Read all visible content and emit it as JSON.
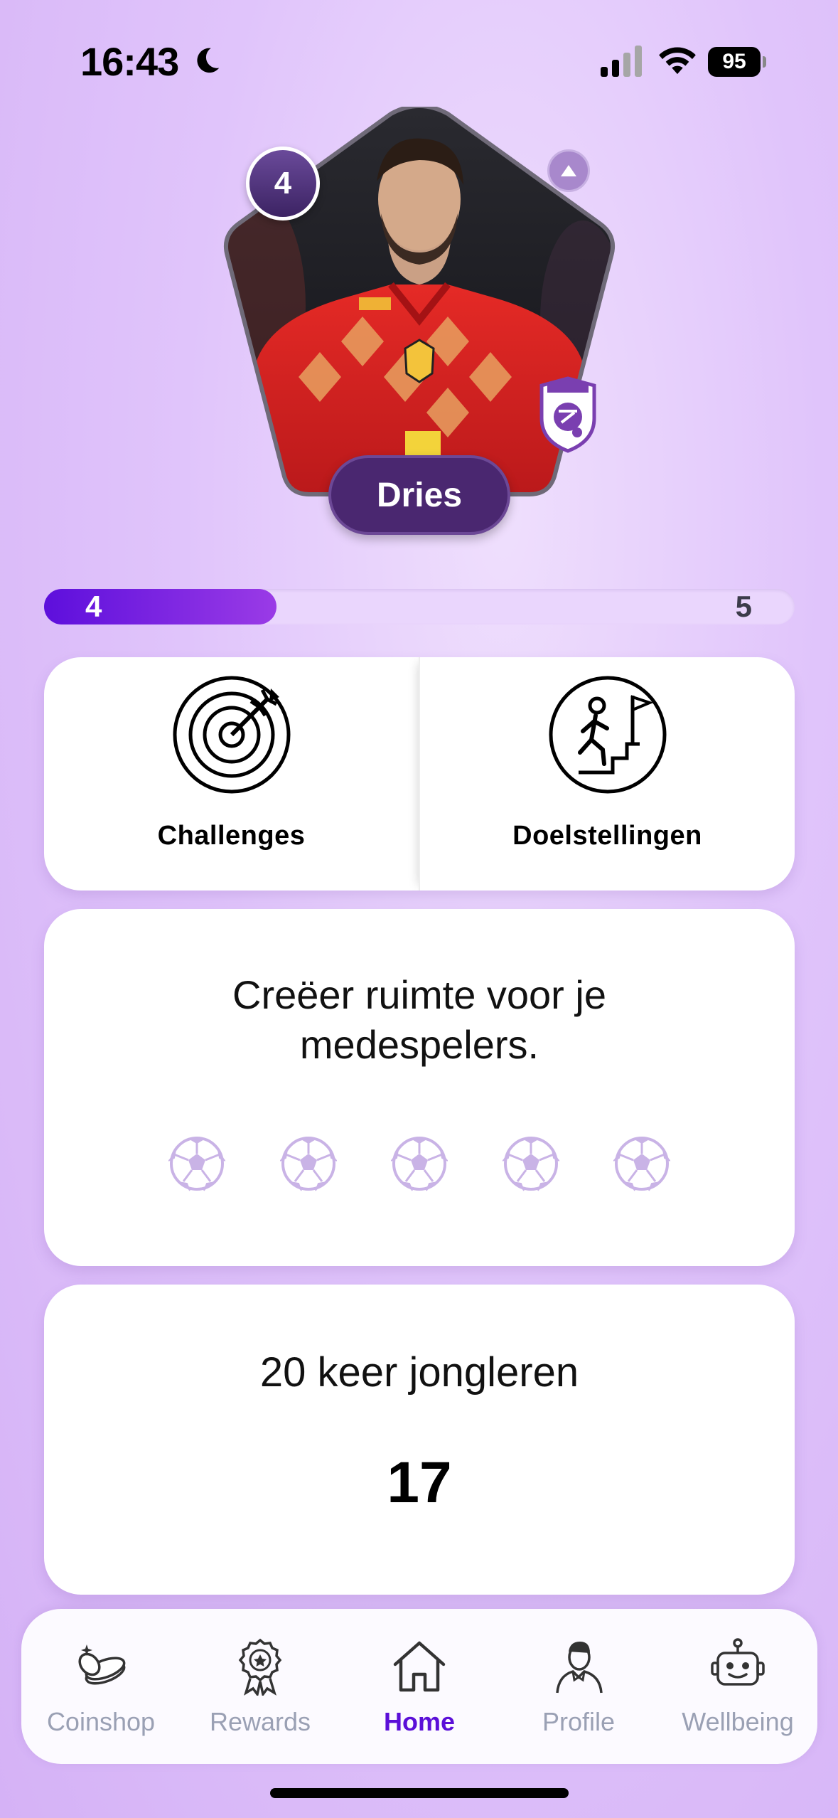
{
  "status_bar": {
    "time": "16:43",
    "battery": "95",
    "icons": [
      "moon-icon",
      "signal-icon",
      "wifi-icon",
      "battery-icon"
    ]
  },
  "player": {
    "name": "Dries",
    "level": "4",
    "photo_icon": "player-photo",
    "club_icon": "club-crest-icon",
    "up_icon": "chevron-up-icon"
  },
  "progress": {
    "current": "4",
    "next": "5",
    "fraction": 0.31
  },
  "actions": [
    {
      "label": "Challenges",
      "icon": "target-icon"
    },
    {
      "label": "Doelstellingen",
      "icon": "stairs-flag-icon"
    }
  ],
  "challenge": {
    "text": "Creëer ruimte voor je medespelers.",
    "rating_total": 5,
    "rating_filled": 0
  },
  "goal": {
    "title": "20 keer jongleren",
    "count": "17"
  },
  "tabs": [
    {
      "label": "Coinshop",
      "icon": "coins-icon",
      "active": false
    },
    {
      "label": "Rewards",
      "icon": "medal-icon",
      "active": false
    },
    {
      "label": "Home",
      "icon": "home-icon",
      "active": true
    },
    {
      "label": "Profile",
      "icon": "profile-icon",
      "active": false
    },
    {
      "label": "Wellbeing",
      "icon": "robot-icon",
      "active": false
    }
  ],
  "colors": {
    "accent": "#5b0fd8",
    "badge": "#4a2770",
    "background": "#dcbff9",
    "inactive_tab": "#9aa0b4"
  }
}
